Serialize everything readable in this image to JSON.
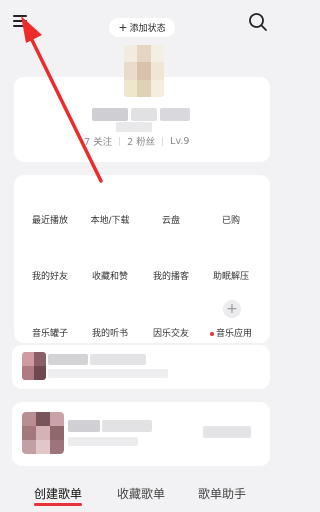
{
  "header": {
    "add_status_label": "添加状态"
  },
  "profile": {
    "following_count": "7 关注",
    "followers_count": "2 粉丝",
    "level": "Lv.9"
  },
  "grid": {
    "items": [
      {
        "label": "最近播放"
      },
      {
        "label": "本地/下载"
      },
      {
        "label": "云盘"
      },
      {
        "label": "已购"
      },
      {
        "label": "我的好友"
      },
      {
        "label": "收藏和赞"
      },
      {
        "label": "我的播客"
      },
      {
        "label": "助眠解压"
      },
      {
        "label": "音乐罐子"
      },
      {
        "label": "我的听书"
      },
      {
        "label": "因乐交友"
      },
      {
        "label": "音乐应用"
      }
    ]
  },
  "tabs": [
    {
      "label": "创建歌单"
    },
    {
      "label": "收藏歌单"
    },
    {
      "label": "歌单助手"
    }
  ],
  "colors": {
    "accent": "#e8353a",
    "background": "#f2f2f4"
  }
}
